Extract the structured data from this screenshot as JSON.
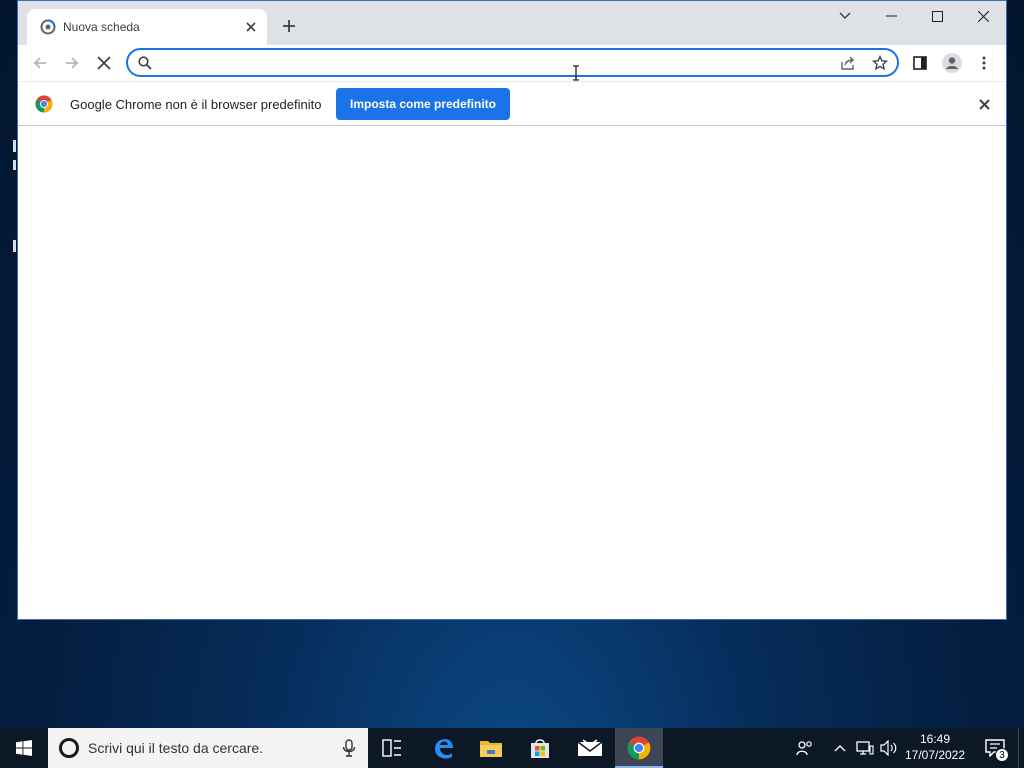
{
  "browser": {
    "tab": {
      "title": "Nuova scheda",
      "favicon": "chrome-loading-icon"
    },
    "new_tab_label": "+",
    "window_controls": [
      "tab-search",
      "minimize",
      "maximize",
      "close"
    ],
    "omnibox": {
      "value": "",
      "placeholder": ""
    },
    "infobar": {
      "message": "Google Chrome non è il browser predefinito",
      "button_label": "Imposta come predefinito"
    },
    "accent_color": "#1a73e8"
  },
  "taskbar": {
    "search_placeholder": "Scrivi qui il testo da cercare.",
    "apps": [
      "task-view",
      "edge",
      "file-explorer",
      "microsoft-store",
      "mail",
      "chrome"
    ],
    "active_app": "chrome",
    "clock": {
      "time": "16:49",
      "date": "17/07/2022"
    },
    "notification_count": "3"
  }
}
